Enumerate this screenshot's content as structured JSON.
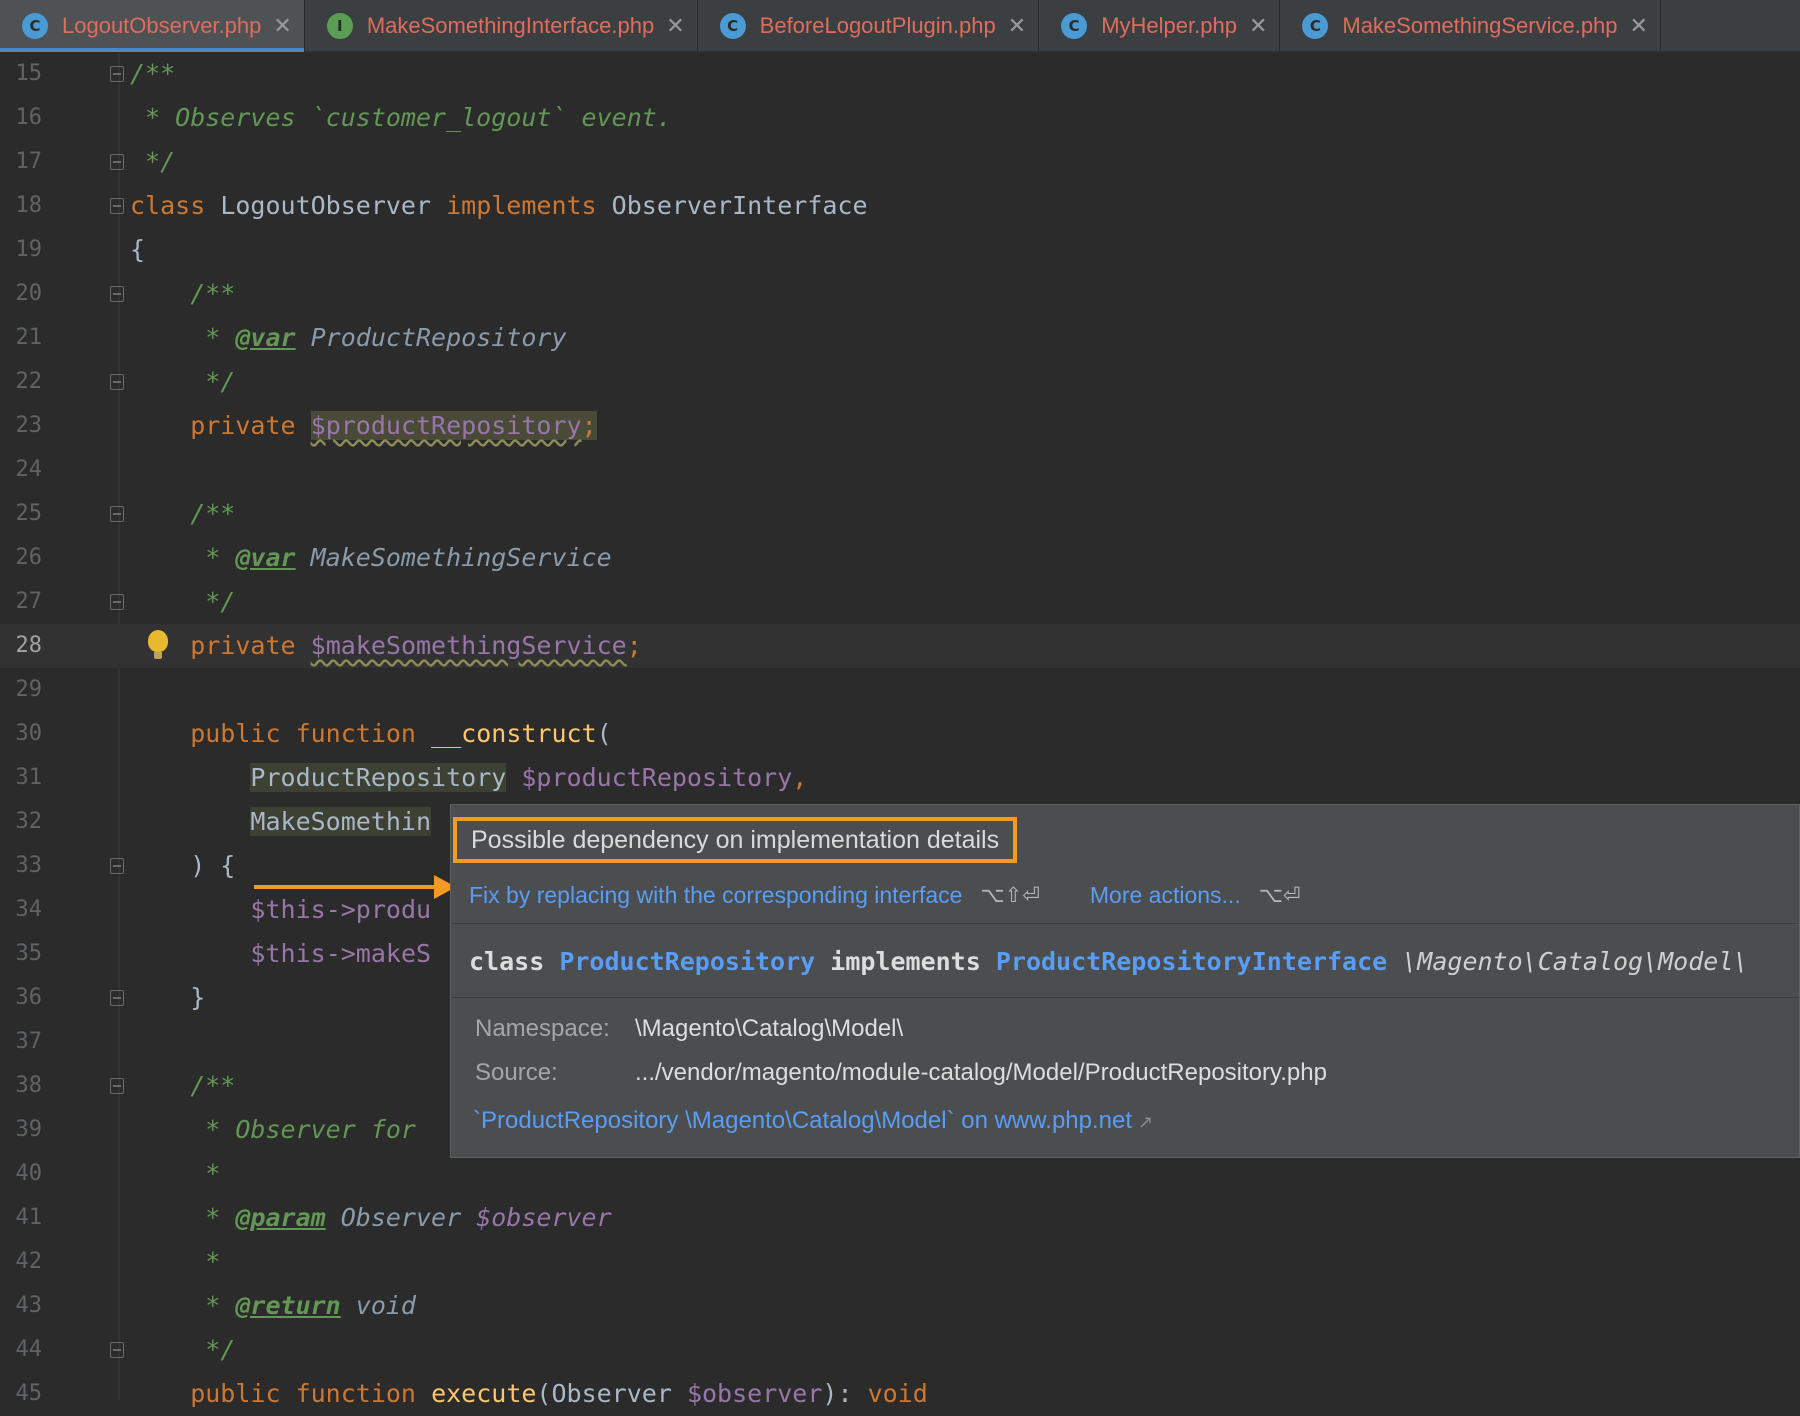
{
  "tabs": [
    {
      "label": "LogoutObserver.php",
      "icon": "class-icon",
      "type": "C",
      "active": true
    },
    {
      "label": "MakeSomethingInterface.php",
      "icon": "interface-icon",
      "type": "I",
      "active": false
    },
    {
      "label": "BeforeLogoutPlugin.php",
      "icon": "class-icon",
      "type": "C",
      "active": false
    },
    {
      "label": "MyHelper.php",
      "icon": "class-icon",
      "type": "C",
      "active": false
    },
    {
      "label": "MakeSomethingService.php",
      "icon": "class-icon",
      "type": "C",
      "active": false
    }
  ],
  "tab_close_glyph": "✕",
  "editor": {
    "current_line": "28",
    "lines": [
      {
        "n": "15",
        "t1": "/**"
      },
      {
        "n": "16",
        "t1": " * Observes `customer_logout` event."
      },
      {
        "n": "17",
        "t1": " */"
      },
      {
        "n": "18",
        "k1": "class",
        "t1": " LogoutObserver ",
        "k2": "implements",
        "t2": " ObserverInterface"
      },
      {
        "n": "19",
        "t1": "{"
      },
      {
        "n": "20",
        "t1": "    /**"
      },
      {
        "n": "21",
        "t1": "     * ",
        "tag": "@var",
        "t2": " ProductRepository"
      },
      {
        "n": "22",
        "t1": "     */"
      },
      {
        "n": "23",
        "k1": "    private",
        "v1": "$productRepository",
        "t2": ";"
      },
      {
        "n": "24"
      },
      {
        "n": "25",
        "t1": "    /**"
      },
      {
        "n": "26",
        "t1": "     * ",
        "tag": "@var",
        "t2": " MakeSomethingService"
      },
      {
        "n": "27",
        "t1": "     */"
      },
      {
        "n": "28",
        "k1": "    private",
        "v1": "$makeSomethingService",
        "t2": ";"
      },
      {
        "n": "29"
      },
      {
        "n": "30",
        "k1": "    public",
        "k2": "function",
        "f1": "__construct",
        "t1": "("
      },
      {
        "n": "31",
        "c1": "ProductRepository",
        "v1": "$productRepository",
        "t1": ","
      },
      {
        "n": "32",
        "c1": "MakeSomethin"
      },
      {
        "n": "33",
        "t1": "    ) {"
      },
      {
        "n": "34",
        "v1": "$this",
        "t1": "->produ"
      },
      {
        "n": "35",
        "v1": "$this",
        "t1": "->makeS"
      },
      {
        "n": "36",
        "t1": "    }"
      },
      {
        "n": "37"
      },
      {
        "n": "38",
        "t1": "    /**"
      },
      {
        "n": "39",
        "t1": "     * Observer for"
      },
      {
        "n": "40",
        "t1": "     *"
      },
      {
        "n": "41",
        "t1": "     * ",
        "tag": "@param",
        "t2": " Observer ",
        "v1": "$observer"
      },
      {
        "n": "42",
        "t1": "     *"
      },
      {
        "n": "43",
        "t1": "     * ",
        "tag": "@return",
        "t2": " void"
      },
      {
        "n": "44",
        "t1": "     */"
      },
      {
        "n": "45",
        "k1": "    public",
        "k2": "function",
        "f1": "execute",
        "t1": "(Observer ",
        "v1": "$observer",
        "t2": "): ",
        "k3": "void"
      }
    ]
  },
  "popup": {
    "problem": "Possible dependency on implementation details",
    "fix_action": "Fix by replacing with the corresponding interface",
    "fix_shortcut": "⌥⇧⏎",
    "more_actions": "More actions...",
    "more_shortcut": "⌥⏎",
    "sig_class_kw": "class",
    "sig_class_name": "ProductRepository",
    "sig_implements": "implements",
    "sig_interface": "ProductRepositoryInterface",
    "sig_namespace": "\\Magento\\Catalog\\Model\\",
    "namespace_label": "Namespace:",
    "namespace_value": "\\Magento\\Catalog\\Model\\",
    "source_label": "Source:",
    "source_value": ".../vendor/magento/module-catalog/Model/ProductRepository.php",
    "external_link": "`ProductRepository \\Magento\\Catalog\\Model` on www.php.net",
    "external_arrow": "↗"
  },
  "colors": {
    "accent": "#f49a23",
    "link": "#589df6",
    "keyword": "#cc7832",
    "comment": "#629755",
    "variable": "#9876aa",
    "tab_text": "#e06c5b"
  }
}
